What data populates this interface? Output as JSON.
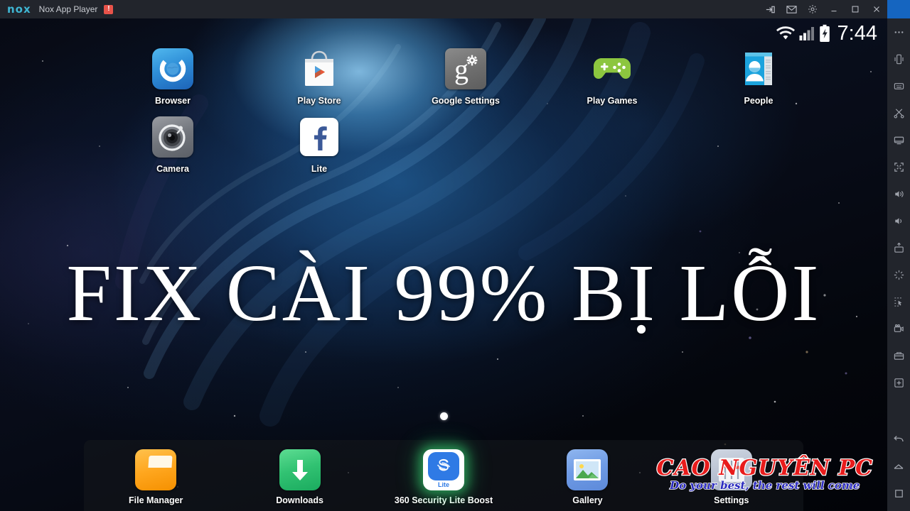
{
  "window": {
    "logo": "nox",
    "title": "Nox App Player",
    "badge": "!",
    "controls": [
      {
        "name": "share-icon",
        "label": "Share"
      },
      {
        "name": "mail-icon",
        "label": "Messages"
      },
      {
        "name": "gear-icon",
        "label": "Settings"
      },
      {
        "name": "minimize-icon",
        "label": "Minimize"
      },
      {
        "name": "maximize-icon",
        "label": "Maximize"
      },
      {
        "name": "close-icon",
        "label": "Close"
      }
    ]
  },
  "sidebar": {
    "items": [
      {
        "name": "more-icon",
        "label": "More"
      },
      {
        "name": "shake-icon",
        "label": "Shake"
      },
      {
        "name": "keyboard-mapping-icon",
        "label": "Keyboard mapping"
      },
      {
        "name": "scissors-icon",
        "label": "Screenshot crop"
      },
      {
        "name": "screen-icon",
        "label": "Screen"
      },
      {
        "name": "fullscreen-icon",
        "label": "Fullscreen"
      },
      {
        "name": "volume-up-icon",
        "label": "Volume up"
      },
      {
        "name": "volume-down-icon",
        "label": "Volume down"
      },
      {
        "name": "apk-install-icon",
        "label": "Install APK"
      },
      {
        "name": "shake-burst-icon",
        "label": "Shake"
      },
      {
        "name": "macro-record-icon",
        "label": "Macro recorder"
      },
      {
        "name": "video-record-icon",
        "label": "Record screen"
      },
      {
        "name": "camera-icon",
        "label": "Screenshot"
      },
      {
        "name": "add-widget-icon",
        "label": "Add"
      },
      {
        "name": "back-icon",
        "label": "Back"
      },
      {
        "name": "home-icon",
        "label": "Home"
      },
      {
        "name": "recents-icon",
        "label": "Recent apps"
      }
    ]
  },
  "statusbar": {
    "wifi": "wifi-icon",
    "signal": "signal-icon",
    "battery": "battery-charging-icon",
    "time": "7:44"
  },
  "home": {
    "rows": [
      [
        {
          "label": "Browser",
          "icon": "browser-icon"
        },
        {
          "label": "Play Store",
          "icon": "play-store-icon"
        },
        {
          "label": "Google Settings",
          "icon": "google-settings-icon"
        },
        {
          "label": "Play Games",
          "icon": "play-games-icon"
        },
        {
          "label": "People",
          "icon": "people-icon"
        }
      ],
      [
        {
          "label": "Camera",
          "icon": "camera-app-icon"
        },
        {
          "label": "Lite",
          "icon": "facebook-lite-icon"
        }
      ]
    ],
    "page_dots": 1,
    "current_page": 1
  },
  "overlay": {
    "headline": "FIX CÀI 99% BỊ LỖI"
  },
  "dock": {
    "items": [
      {
        "label": "File Manager",
        "icon": "file-manager-icon"
      },
      {
        "label": "Downloads",
        "icon": "downloads-icon"
      },
      {
        "label": "360 Security Lite Boost",
        "icon": "security-360-icon",
        "badge": "Lite",
        "highlighted": true
      },
      {
        "label": "Gallery",
        "icon": "gallery-icon"
      },
      {
        "label": "Settings",
        "icon": "settings-icon"
      }
    ]
  },
  "watermark": {
    "brand": "CAO NGUYÊN PC",
    "tagline": "Do your best, the rest will come",
    "brand_color": "#e81c1c",
    "tagline_color": "#2b2bbf"
  },
  "colors": {
    "chrome": "#22252c",
    "accent": "#3fb6d3",
    "sidebar_accent": "#1565c0"
  }
}
